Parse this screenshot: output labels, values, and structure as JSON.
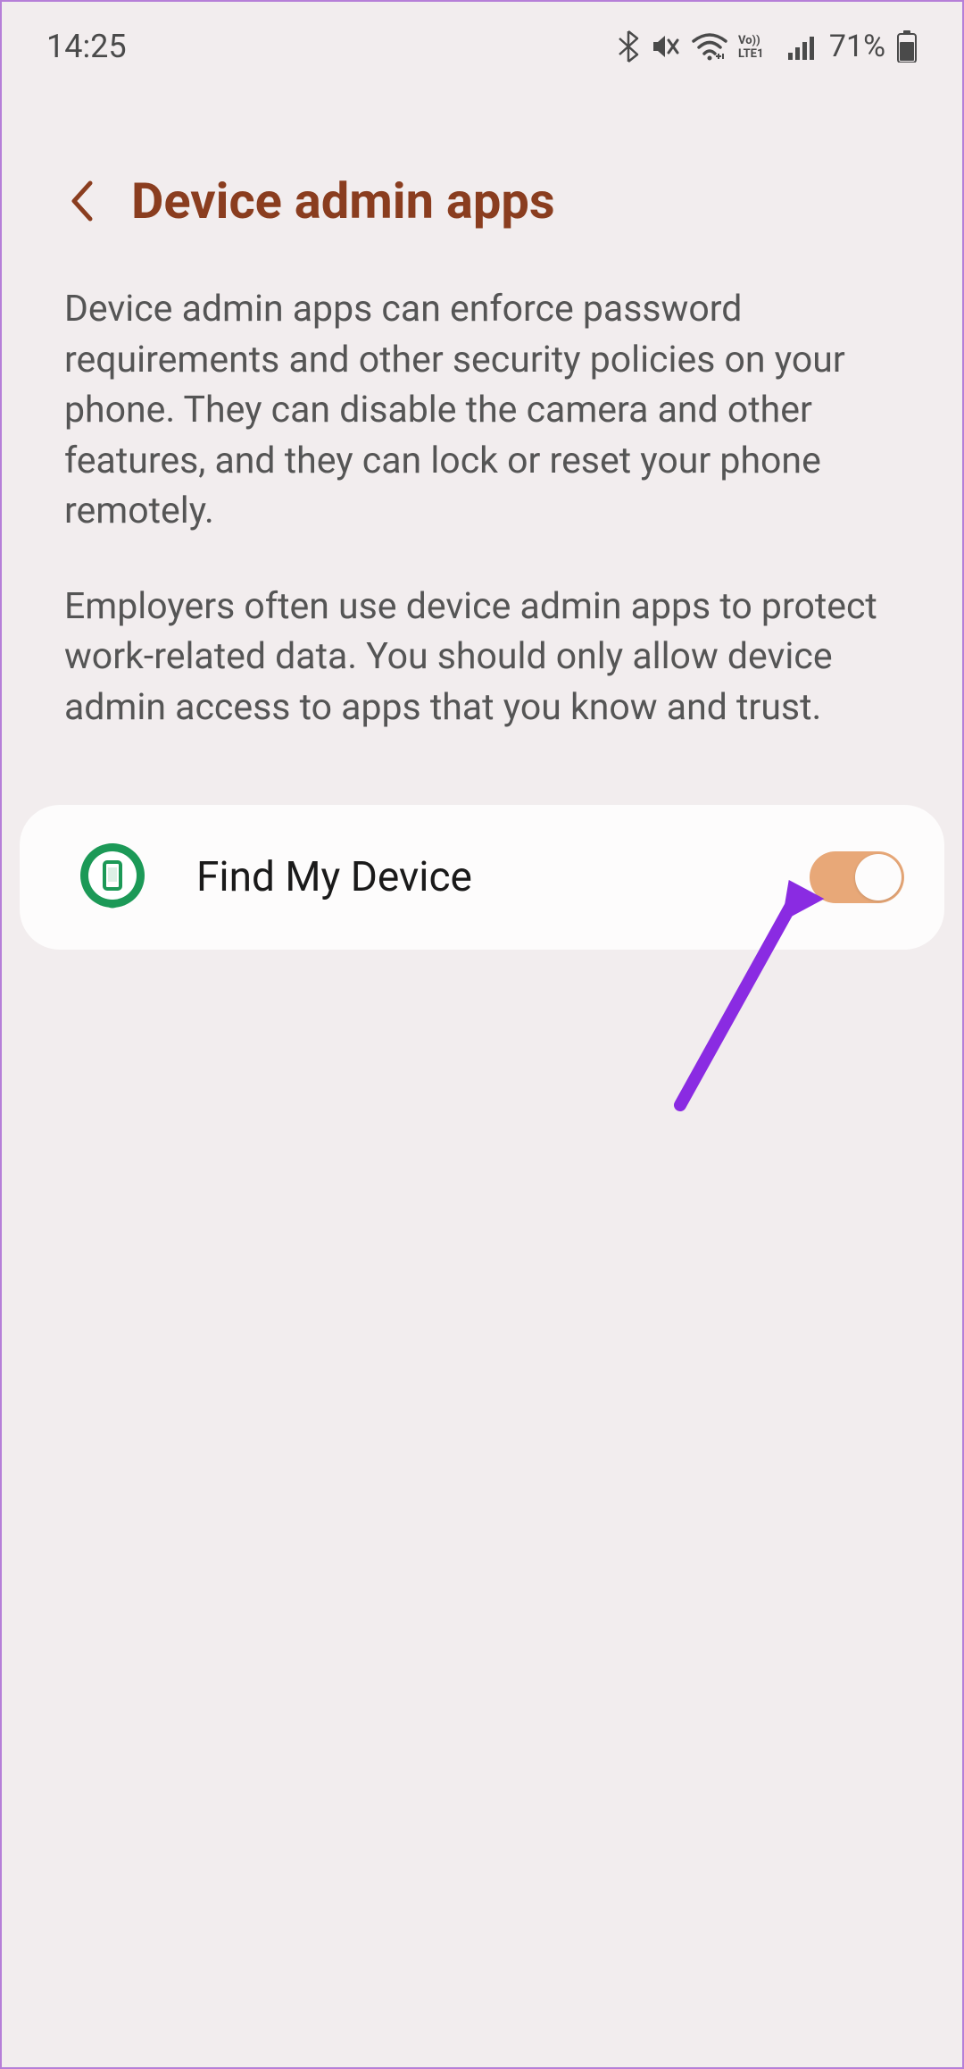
{
  "status": {
    "time": "14:25",
    "battery": "71%"
  },
  "header": {
    "title": "Device admin apps"
  },
  "description": {
    "paragraph1": "Device admin apps can enforce password requirements and other security policies on your phone. They can disable the camera and other features, and they can lock or reset your phone remotely.",
    "paragraph2": "Employers often use device admin apps to protect work-related data. You should only allow device admin access to apps that you know and trust."
  },
  "apps": [
    {
      "name": "Find My Device",
      "enabled": true
    }
  ]
}
